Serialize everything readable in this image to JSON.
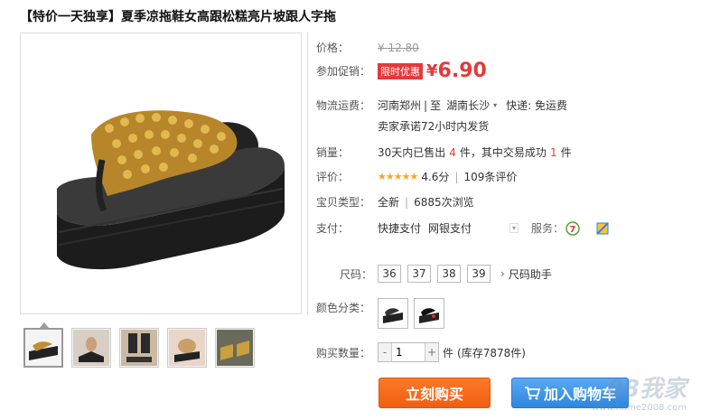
{
  "title": "【特价一天独享】夏季凉拖鞋女高跟松糕亮片坡跟人字拖",
  "price": {
    "label": "价格：",
    "original": "¥ 12.80",
    "promo_label": "参加促销：",
    "promo_badge": "限时优惠",
    "currency": "¥",
    "current": "6.90"
  },
  "logistics": {
    "label": "物流运费：",
    "from": "河南郑州",
    "sep": "|",
    "to_prefix": "至",
    "to": "湖南长沙",
    "express": "快递: 免运费",
    "promise": "卖家承诺72小时内发货"
  },
  "sales": {
    "label": "销量：",
    "part1": "30天内已售出",
    "sold": "4",
    "part2": "件，其中交易成功",
    "success": "1",
    "part3": "件"
  },
  "rating": {
    "label": "评价：",
    "stars": "★★★★★",
    "score": "4.6分",
    "sep": "|",
    "reviews": "109条评价"
  },
  "item_type": {
    "label": "宝贝类型：",
    "value": "全新",
    "sep": "|",
    "views": "6885次浏览"
  },
  "payment": {
    "label": "支付：",
    "opt1": "快捷支付",
    "opt2": "网银支付",
    "service_label": "服务："
  },
  "size": {
    "label": "尺码：",
    "options": [
      "36",
      "37",
      "38",
      "39"
    ],
    "helper": "尺码助手"
  },
  "color": {
    "label": "颜色分类："
  },
  "quantity": {
    "label": "购买数量：",
    "minus": "-",
    "value": "1",
    "plus": "+",
    "unit": "件",
    "stock": "(库存7878件)"
  },
  "buttons": {
    "buy_now": "立刻购买",
    "add_cart": "加入购物车"
  },
  "watermark": {
    "brand": "08我家",
    "url": "www.home2008.com"
  },
  "colors": {
    "accent_red": "#e4393c",
    "buy_orange": "#f25d0f",
    "cart_blue": "#2d86e0"
  }
}
